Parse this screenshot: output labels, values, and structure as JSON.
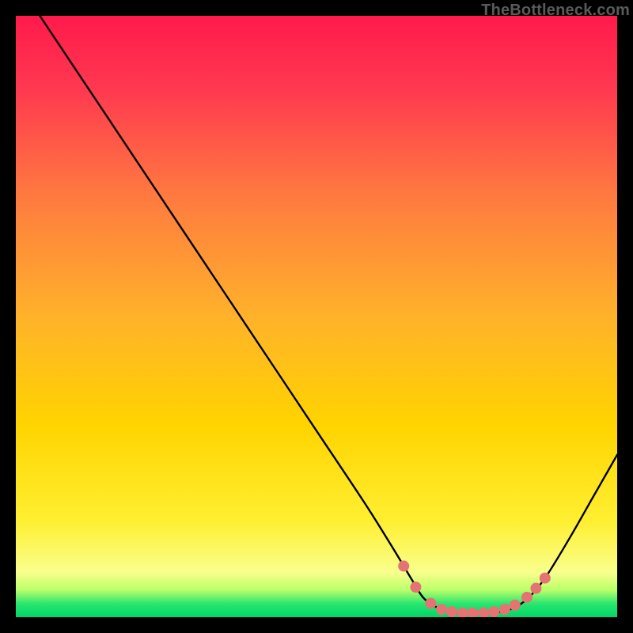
{
  "watermark": "TheBottleneck.com",
  "chart_data": {
    "type": "line",
    "title": "",
    "xlabel": "",
    "ylabel": "",
    "xlim": [
      0,
      100
    ],
    "ylim": [
      0,
      100
    ],
    "background_gradient": {
      "top_color": "#ff1a4b",
      "mid_color": "#ffd400",
      "bottom_bands": [
        "#f9ff8c",
        "#b9ff6a",
        "#28e66f",
        "#00d56a"
      ]
    },
    "curve": {
      "color": "#000000",
      "width": 2,
      "points_xy": [
        [
          4,
          100
        ],
        [
          10,
          91
        ],
        [
          20,
          76
        ],
        [
          30,
          61
        ],
        [
          40,
          46
        ],
        [
          50,
          31
        ],
        [
          58,
          19
        ],
        [
          63,
          11
        ],
        [
          66,
          6
        ],
        [
          68,
          3
        ],
        [
          71,
          1.2
        ],
        [
          74,
          0.7
        ],
        [
          78,
          0.7
        ],
        [
          82,
          1.2
        ],
        [
          85,
          3
        ],
        [
          88,
          6.5
        ],
        [
          92,
          13
        ],
        [
          96,
          20
        ],
        [
          100,
          27
        ]
      ]
    },
    "scatter_markers": {
      "color": "#e57373",
      "radius": 7,
      "points_xy": [
        [
          64.5,
          8.5
        ],
        [
          66.5,
          5.0
        ],
        [
          69.0,
          2.3
        ],
        [
          70.8,
          1.3
        ],
        [
          72.5,
          0.9
        ],
        [
          74.3,
          0.7
        ],
        [
          76.0,
          0.7
        ],
        [
          77.8,
          0.7
        ],
        [
          79.5,
          0.9
        ],
        [
          81.3,
          1.3
        ],
        [
          83.0,
          2.0
        ],
        [
          85.0,
          3.3
        ],
        [
          86.5,
          4.8
        ],
        [
          88.0,
          6.5
        ]
      ]
    }
  }
}
